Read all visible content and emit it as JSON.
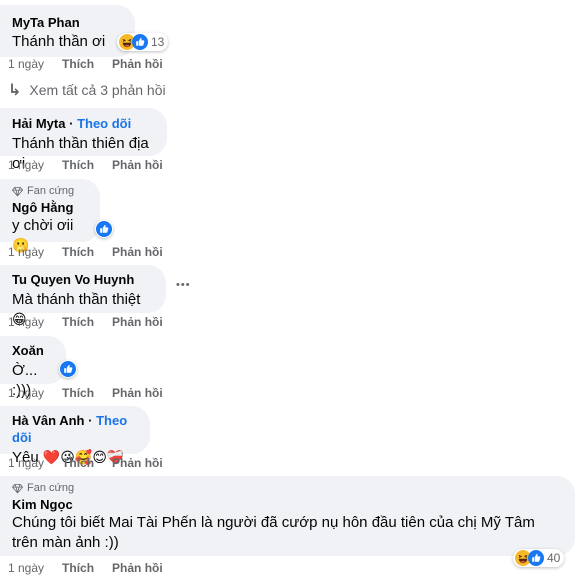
{
  "comments": [
    {
      "name": "MyTa Phan",
      "text": "Thánh thần ơi",
      "reactions": {
        "icons": [
          "haha-icon",
          "like-icon"
        ],
        "count": "13"
      },
      "meta": {
        "time": "1 ngày",
        "like": "Thích",
        "reply": "Phản hồi"
      }
    },
    {
      "name": "Hải Myta",
      "follow": "Theo dõi",
      "text": "Thánh thần thiên địa ơi",
      "meta": {
        "time": "1 ngày",
        "like": "Thích",
        "reply": "Phản hồi"
      }
    },
    {
      "badge": "Fan cứng",
      "name": "Ngô Hằng",
      "text": "y chời ơii",
      "emoji": "🫢",
      "reactions": {
        "icons": [
          "like-icon"
        ],
        "count": ""
      },
      "meta": {
        "time": "1 ngày",
        "like": "Thích",
        "reply": "Phản hồi"
      }
    },
    {
      "name": "Tu Quyen Vo Huynh",
      "text": "Mà thánh thần thiệt",
      "emoji": "😁",
      "more": "•••",
      "meta": {
        "time": "1 ngày",
        "like": "Thích",
        "reply": "Phản hồi"
      }
    },
    {
      "name": "Xoăn",
      "text": "Ờ... :)))",
      "reactions": {
        "icons": [
          "like-icon"
        ],
        "count": ""
      },
      "meta": {
        "time": "1 ngày",
        "like": "Thích",
        "reply": "Phản hồi"
      }
    },
    {
      "name": "Hà Vân Anh",
      "follow": "Theo dõi",
      "text": "Yêu",
      "emoji": "❤️😘🥰😊❤️‍🩹",
      "meta": {
        "time": "1 ngày",
        "like": "Thích",
        "reply": "Phản hồi"
      }
    },
    {
      "badge": "Fan cứng",
      "name": "Kim Ngọc",
      "text": "Chúng tôi biết Mai Tài Phến là người đã cướp nụ hôn đầu tiên của chị Mỹ Tâm trên màn ảnh :))",
      "reactions": {
        "icons": [
          "haha-icon",
          "like-icon"
        ],
        "count": "40"
      },
      "meta": {
        "time": "1 ngày",
        "like": "Thích",
        "reply": "Phản hồi"
      }
    }
  ],
  "view_replies": "Xem tất cả 3 phản hồi",
  "colors": {
    "bubble": "#f0f2f5",
    "like_blue": "#1877f2",
    "haha_yellow": "#f7b928",
    "follow_blue": "#1a73e8"
  }
}
